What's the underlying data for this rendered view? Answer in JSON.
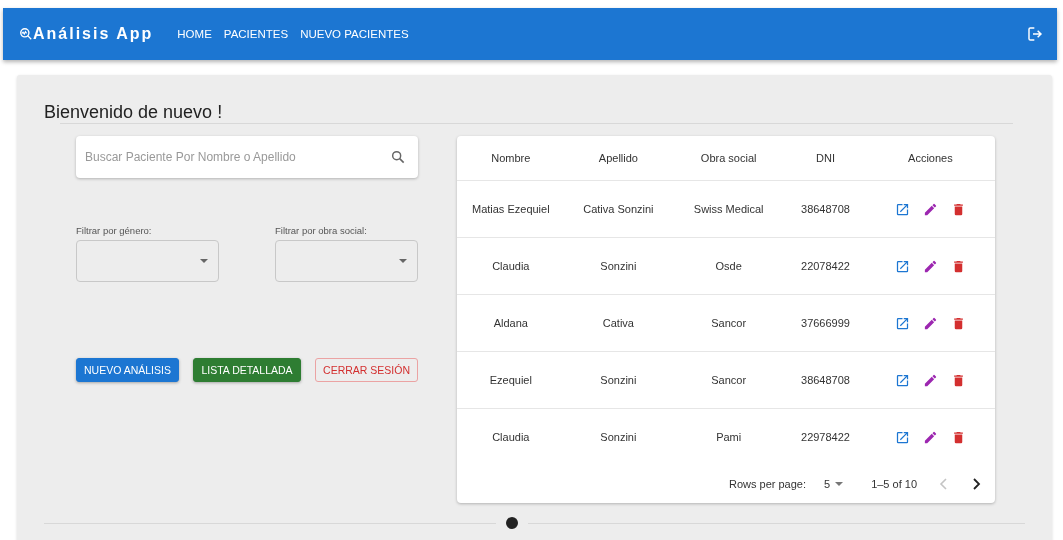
{
  "header": {
    "app_title": "Análisis App",
    "nav": [
      {
        "label": "HOME"
      },
      {
        "label": "PACIENTES"
      },
      {
        "label": "NUEVO PACIENTES"
      }
    ]
  },
  "welcome": "Bienvenido de nuevo !",
  "search": {
    "placeholder": "Buscar Paciente Por Nombre o Apellido"
  },
  "filters": [
    {
      "label": "Filtrar por género:"
    },
    {
      "label": "Filtrar por obra social:"
    }
  ],
  "buttons": [
    {
      "label": "NUEVO ANÁLISIS",
      "kind": "primary"
    },
    {
      "label": "LISTA DETALLADA",
      "kind": "success"
    },
    {
      "label": "CERRAR SESIÓN",
      "kind": "outline"
    }
  ],
  "table": {
    "columns": [
      "Nombre",
      "Apellido",
      "Obra social",
      "DNI",
      "Acciones"
    ],
    "rows": [
      {
        "cells": [
          "Matias Ezequiel",
          "Cativa Sonzini",
          "Swiss Medical",
          "38648708"
        ]
      },
      {
        "cells": [
          "Claudia",
          "Sonzini",
          "Osde",
          "22078422"
        ]
      },
      {
        "cells": [
          "Aldana",
          "Cativa",
          "Sancor",
          "37666999"
        ]
      },
      {
        "cells": [
          "Ezequiel",
          "Sonzini",
          "Sancor",
          "38648708"
        ]
      },
      {
        "cells": [
          "Claudia",
          "Sonzini",
          "Pami",
          "22978422"
        ]
      }
    ],
    "pagination": {
      "rows_per_page_label": "Rows per page:",
      "rows_per_page": "5",
      "range": "1–5 of 10",
      "prev_disabled": true,
      "next_disabled": false
    }
  }
}
